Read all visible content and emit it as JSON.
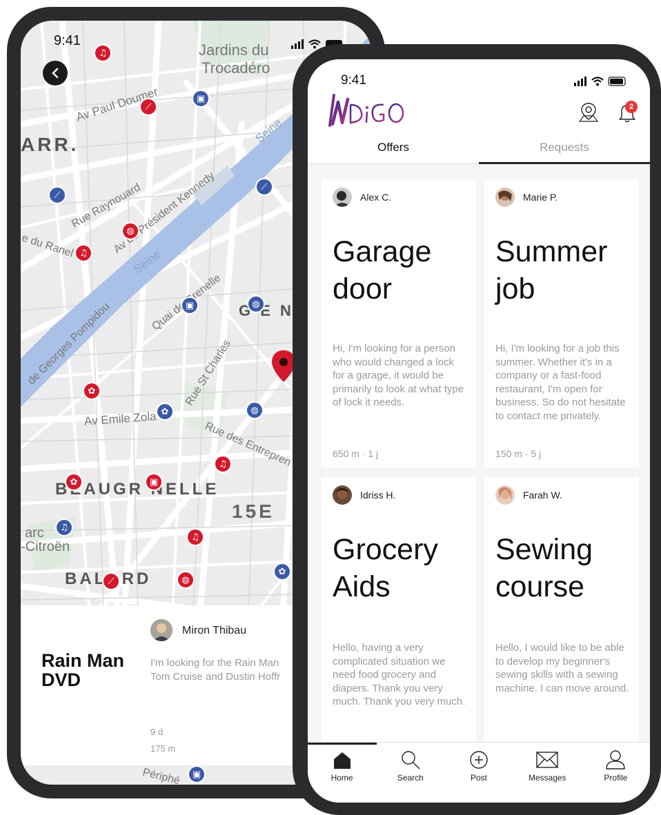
{
  "back_screen": {
    "status_time": "9:41",
    "map_labels": {
      "jardins": "Jardins du",
      "trocadero": "Trocadéro",
      "av_paul_doumer": "Av Paul Doumer",
      "arr": "ARR.",
      "rue_raynouard": "Rue Raynouard",
      "av_president_kennedy": "Av du Président Kennedy",
      "rue_du_ranelagh": "e du Ranel",
      "seine_1": "Seine",
      "seine_2": "Seine",
      "quai_de_grenelle": "Quai de Grenelle",
      "georges_pompidou": "de Georges Pompidou",
      "rue_st_charles": "Rue St Charles",
      "grenelle": "G  E N",
      "av_emile_zola": "Av Emile Zola",
      "rue_des_entrepreneurs": "Rue des Entrepren",
      "beaugrenelle": "BEAUGR   NELLE",
      "15e": "15E",
      "parc_citroen_1": "arc",
      "parc_citroen_2": "-Citroën",
      "balard": "BALARD",
      "peripherique": "Périphé"
    },
    "detail": {
      "title": "Rain Man DVD",
      "user_name": "Miron Thibau",
      "description_line1": "I'm looking for the Rain Man",
      "description_line2": "Tom Cruise and Dustin Hoffr",
      "age": "9 d",
      "distance": "175 m"
    }
  },
  "front_screen": {
    "status_time": "9:41",
    "app_name": "INDiGO",
    "notification_count": "2",
    "tabs": [
      {
        "label": "Offers"
      },
      {
        "label": "Requests"
      }
    ],
    "cards": [
      {
        "user": "Alex C.",
        "title": "Garage door",
        "description": "Hi, I'm looking for a person who would changed a lock for a garage, it would be primarily to look at what type of lock it needs.",
        "meta": "650 m · 1 j"
      },
      {
        "user": "Marie P.",
        "title": "Summer job",
        "description": "Hi, I'm looking for a job this summer. Whether it's in a company or a fast-food restaurant, I'm open for business. So do not hesitate to contact me privately.",
        "meta": "150 m · 5 j"
      },
      {
        "user": "Idriss H.",
        "title": "Grocery Aids",
        "description": "Hello, having a very complicated situation we need food grocery and diapers. Thank you very much. Thank you very much.",
        "meta": ""
      },
      {
        "user": "Farah W.",
        "title": "Sewing course",
        "description": "Hello, I would like to be able to develop my beginner's sewing skills with a sewing machine. I can move around.",
        "meta": ""
      }
    ],
    "nav": [
      {
        "label": "Home",
        "icon": "home-icon"
      },
      {
        "label": "Search",
        "icon": "search-icon"
      },
      {
        "label": "Post",
        "icon": "plus-circle-icon"
      },
      {
        "label": "Messages",
        "icon": "envelope-icon"
      },
      {
        "label": "Profile",
        "icon": "user-icon"
      }
    ]
  },
  "colors": {
    "pin_red": "#d4192c",
    "pin_blue": "#3a5aa6",
    "river": "#a9c1e6",
    "badge": "#e53935",
    "logo_gradient_start": "#3b2a8a",
    "logo_gradient_end": "#b23a8a"
  }
}
